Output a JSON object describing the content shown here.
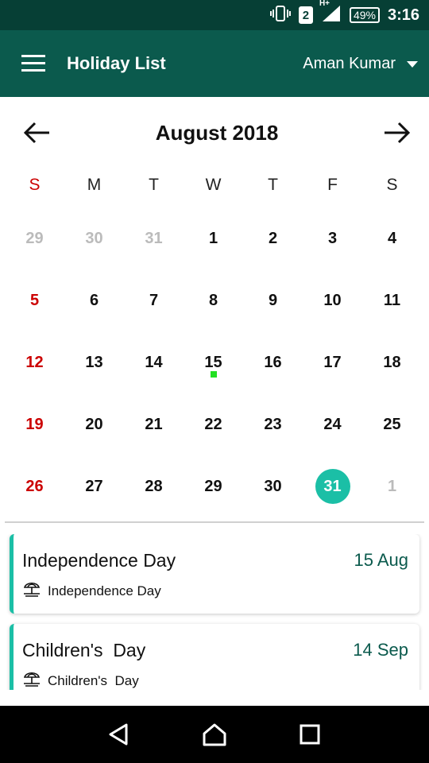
{
  "status_bar": {
    "sim_slot": "2",
    "network": "H+",
    "battery": "49%",
    "time": "3:16"
  },
  "app_bar": {
    "title": "Holiday List",
    "user_name": "Aman Kumar",
    "menu_icon": "hamburger-icon",
    "dropdown_icon": "caret-down-icon"
  },
  "calendar": {
    "month_label": "August 2018",
    "weekdays": [
      "S",
      "M",
      "T",
      "W",
      "T",
      "F",
      "S"
    ],
    "weeks": [
      [
        "29",
        "30",
        "31",
        "1",
        "2",
        "3",
        "4"
      ],
      [
        "5",
        "6",
        "7",
        "8",
        "9",
        "10",
        "11"
      ],
      [
        "12",
        "13",
        "14",
        "15",
        "16",
        "17",
        "18"
      ],
      [
        "19",
        "20",
        "21",
        "22",
        "23",
        "24",
        "25"
      ],
      [
        "26",
        "27",
        "28",
        "29",
        "30",
        "31",
        "1"
      ]
    ],
    "selected_day": "31",
    "holiday_marker_day": "15"
  },
  "holidays": [
    {
      "name": "Independence Day",
      "date": "15 Aug",
      "detail": "Independence Day"
    },
    {
      "name": "Children's  Day",
      "date": "14 Sep",
      "detail": "Children's  Day"
    }
  ],
  "colors": {
    "status_bar": "#063f35",
    "app_bar": "#0b5a4d",
    "accent": "#1bbfa6",
    "sunday": "#cc0000",
    "holiday_dot": "#22e022"
  }
}
